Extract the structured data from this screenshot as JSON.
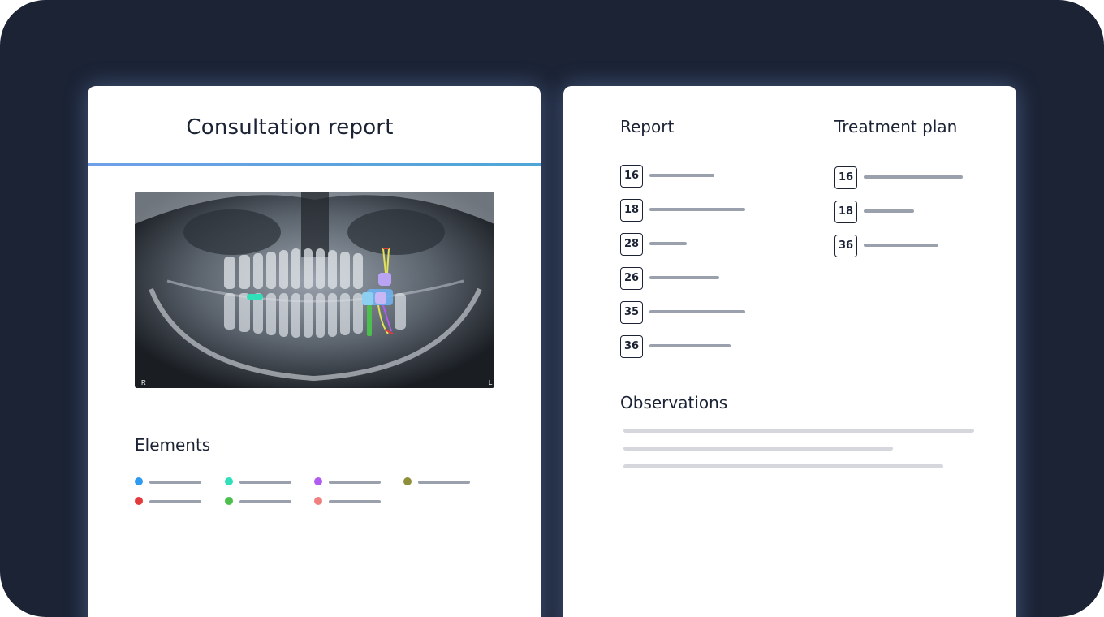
{
  "left_card": {
    "title": "Consultation report",
    "image": {
      "name": "panoramic-dental-xray"
    },
    "elements": {
      "title": "Elements",
      "legend": [
        {
          "color": "#2f9bf0"
        },
        {
          "color": "#2fe0b8"
        },
        {
          "color": "#b05cf0"
        },
        {
          "color": "#8f8f3a"
        },
        {
          "color": "#e33a3a"
        },
        {
          "color": "#4cc04c"
        },
        {
          "color": "#f08080"
        }
      ]
    }
  },
  "right_card": {
    "report": {
      "title": "Report",
      "teeth": [
        "16",
        "18",
        "28",
        "26",
        "35",
        "36"
      ]
    },
    "treatment_plan": {
      "title": "Treatment plan",
      "teeth": [
        "16",
        "18",
        "36"
      ]
    },
    "observations": {
      "title": "Observations"
    }
  }
}
